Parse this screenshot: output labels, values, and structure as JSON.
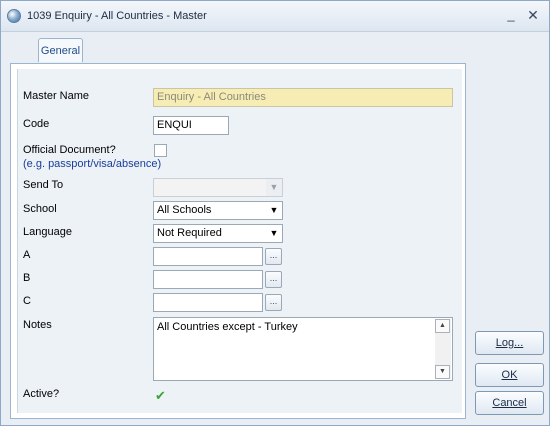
{
  "window": {
    "title": "1039 Enquiry - All Countries - Master"
  },
  "tabs": [
    {
      "label": "General",
      "selected": true
    }
  ],
  "form": {
    "master_name": {
      "label": "Master Name",
      "value": "Enquiry - All Countries"
    },
    "code": {
      "label": "Code",
      "value": "ENQUI"
    },
    "official_document": {
      "label": "Official Document?",
      "hint": "(e.g. passport/visa/absence)",
      "checked": false
    },
    "send_to": {
      "label": "Send To",
      "value": ""
    },
    "school": {
      "label": "School",
      "value": "All Schools"
    },
    "language": {
      "label": "Language",
      "value": "Not Required"
    },
    "a": {
      "label": "A",
      "value": "",
      "button": "..."
    },
    "b": {
      "label": "B",
      "value": "",
      "button": "..."
    },
    "c": {
      "label": "C",
      "value": "",
      "button": "..."
    },
    "notes": {
      "label": "Notes",
      "value": "All Countries except - Turkey"
    },
    "active": {
      "label": "Active?",
      "checked": true
    }
  },
  "buttons": {
    "log": "Log...",
    "ok": "OK",
    "cancel": "Cancel"
  },
  "icons": {
    "app": "globe-icon",
    "minimize": "minimize-icon",
    "close": "close-icon",
    "dropdown": "chevron-down-icon",
    "checkmark": "checkmark-icon"
  },
  "colors": {
    "title_bar": "#dde6f0",
    "readonly_field": "#f7edb4",
    "hint_text": "#1a3d99",
    "checkmark": "#3aa336",
    "tab_text": "#1e4a8c"
  }
}
